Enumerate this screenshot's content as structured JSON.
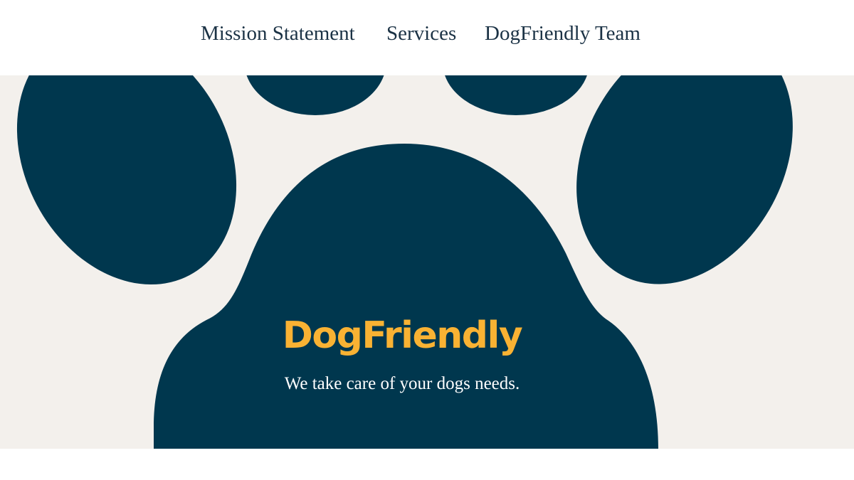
{
  "nav": {
    "items": [
      {
        "label": "Mission Statement"
      },
      {
        "label": "Services"
      },
      {
        "label": "DogFriendly Team"
      }
    ]
  },
  "hero": {
    "title": "DogFriendly",
    "tagline": "We take care of your dogs needs."
  },
  "colors": {
    "paw": "#00374e",
    "hero_background": "#f3f0ec",
    "title": "#f9b233",
    "tagline": "#ffffff",
    "nav_text": "#1b3245"
  },
  "icons": {
    "hero_graphic": "paw-print-icon"
  }
}
